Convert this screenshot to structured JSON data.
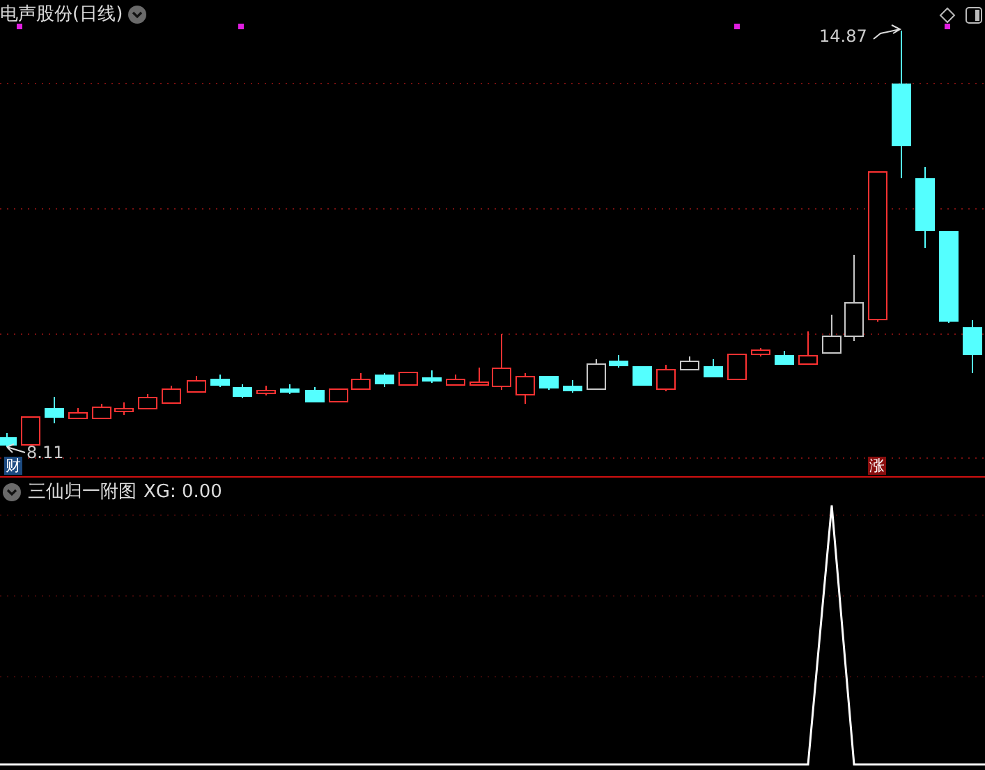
{
  "main_panel": {
    "title": "电声股份(日线)",
    "high_label": "14.87",
    "low_label": "8.11",
    "badges": [
      {
        "text": "财",
        "kind": "info"
      },
      {
        "text": "涨",
        "kind": "rise"
      }
    ]
  },
  "indicator_panel": {
    "title": "三仙归一附图",
    "reading": "XG: 0.00"
  }
}
